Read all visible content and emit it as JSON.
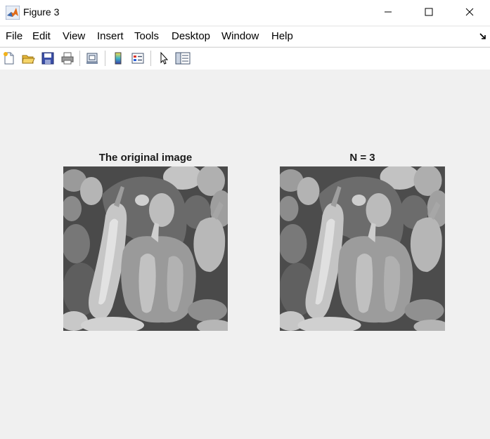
{
  "window": {
    "title": "Figure 3",
    "app_icon": "matlab-logo-icon",
    "controls": [
      "minimize-icon",
      "maximize-icon",
      "close-icon"
    ]
  },
  "menu": {
    "items": [
      "File",
      "Edit",
      "View",
      "Insert",
      "Tools",
      "Desktop",
      "Window",
      "Help"
    ],
    "dock_icon": "dock-arrow-icon"
  },
  "toolbar": {
    "buttons": [
      "new-figure-icon",
      "open-file-icon",
      "save-icon",
      "print-icon",
      "link-plot-icon",
      "insert-colorbar-icon",
      "insert-legend-icon",
      "edit-plot-arrow-icon",
      "property-inspector-icon"
    ]
  },
  "figure": {
    "axes": [
      {
        "title": "The original image",
        "image": "grayscale peppers image"
      },
      {
        "title": "N = 3",
        "image": "grayscale peppers image"
      }
    ]
  }
}
